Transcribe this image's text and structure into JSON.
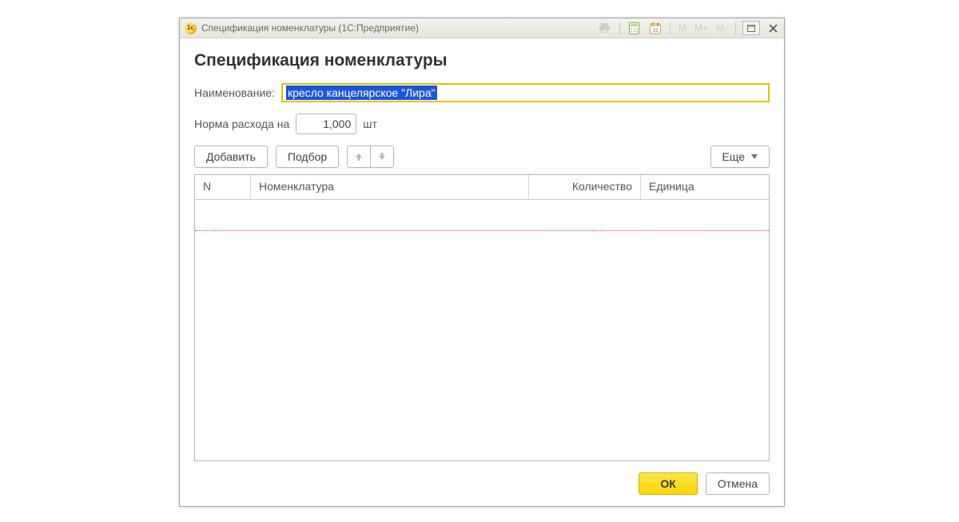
{
  "window": {
    "title": "Спецификация номенклатуры  (1С:Предприятие)",
    "app_icon_text": "1c"
  },
  "titlebar_controls": {
    "m1": "M",
    "m2": "M+",
    "m3": "M-"
  },
  "page": {
    "heading": "Спецификация номенклатуры"
  },
  "fields": {
    "name_label": "Наименование:",
    "name_value": "кресло канцелярское \"Лира\"",
    "rate_label": "Норма расхода на",
    "rate_value": "1,000",
    "rate_unit": "шт"
  },
  "toolbar": {
    "add": "Добавить",
    "pick": "Подбор",
    "more": "Еще"
  },
  "table": {
    "columns": {
      "n": "N",
      "nomenclature": "Номенклатура",
      "quantity": "Количество",
      "unit": "Единица"
    },
    "rows": []
  },
  "footer": {
    "ok": "ОК",
    "cancel": "Отмена"
  }
}
